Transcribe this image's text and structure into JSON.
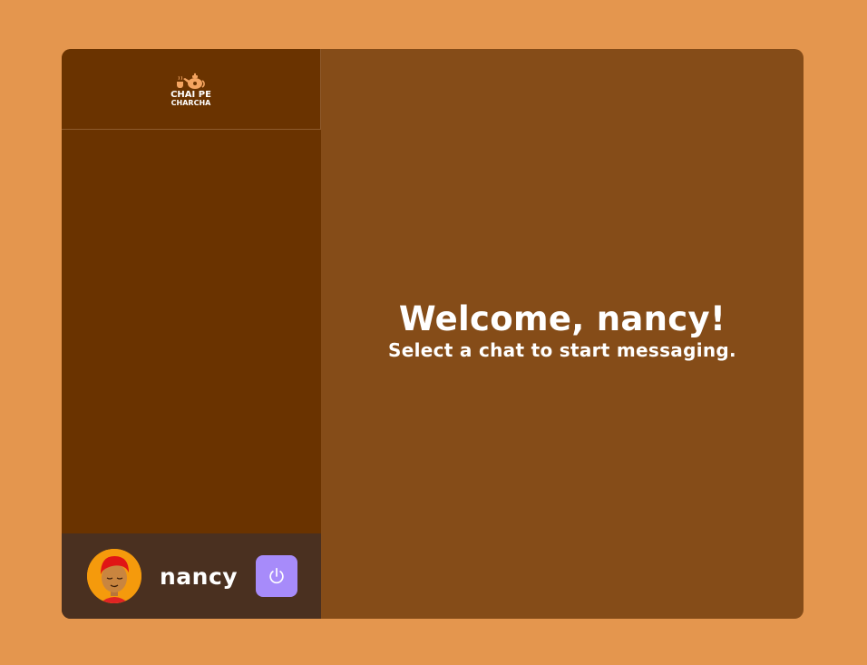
{
  "logo": {
    "line1": "CHAI PE",
    "line2": "CHARCHA",
    "icon": "teapot-icon"
  },
  "user": {
    "name": "nancy",
    "avatar_icon": "avatar-icon",
    "logout_icon": "power-icon"
  },
  "main": {
    "title": "Welcome, nancy!",
    "subtitle": "Select a chat to start messaging."
  },
  "colors": {
    "page_bg": "#E4964E",
    "sidebar_bg": "#6A3300",
    "main_bg": "#854C18",
    "footer_bg": "#4A3020",
    "logout_bg": "#A78BFA",
    "avatar_bg": "#F59A0C"
  }
}
